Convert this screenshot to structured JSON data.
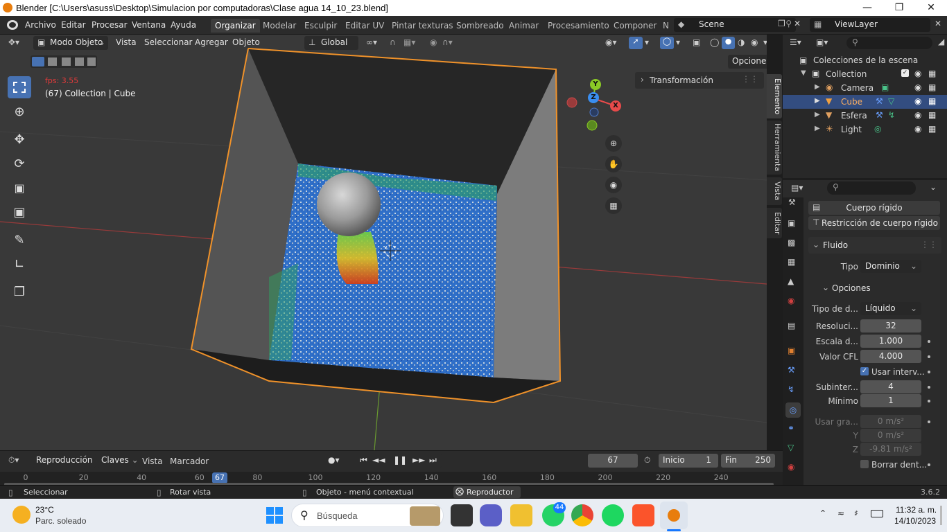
{
  "titlebar": {
    "title": "Blender [C:\\Users\\asuss\\Desktop\\Simulacion por computadoras\\Clase agua 14_10_23.blend]"
  },
  "menu": [
    "Archivo",
    "Editar",
    "Procesar",
    "Ventana",
    "Ayuda"
  ],
  "workspaces": [
    "Organizar",
    "Modelar",
    "Esculpir",
    "Editar UV",
    "Pintar texturas",
    "Sombreado",
    "Animar",
    "Procesamiento",
    "Componer",
    "N"
  ],
  "scene": "Scene",
  "view_layer": "ViewLayer",
  "viewport": {
    "mode": "Modo Objeto",
    "header_menus": [
      "Vista",
      "Seleccionar",
      "Agregar",
      "Objeto"
    ],
    "orientation": "Global",
    "options_label": "Opciones",
    "fps": "fps: 3.55",
    "info": "(67) Collection | Cube",
    "sidebar_panel": "Transformación",
    "gizmo_x": "X",
    "gizmo_y": "Y",
    "gizmo_z": "Z"
  },
  "side_tabs": [
    "Elemento",
    "Herramienta",
    "Vista",
    "Editar"
  ],
  "outliner": {
    "root": "Colecciones de la escena",
    "items": [
      {
        "name": "Collection",
        "level": 1
      },
      {
        "name": "Camera",
        "level": 2
      },
      {
        "name": "Cube",
        "level": 2,
        "selected": true
      },
      {
        "name": "Esfera",
        "level": 2
      },
      {
        "name": "Light",
        "level": 2
      }
    ]
  },
  "properties": {
    "btn_rigid": "Cuerpo rígido",
    "btn_rigid_constraint": "Restricción de cuerpo rígido",
    "panel_fluid": "Fluido",
    "tipo_label": "Tipo",
    "tipo_value": "Dominio",
    "subpanel_opciones": "Opciones",
    "rows": [
      {
        "label": "Tipo de d...",
        "value": "Líquido",
        "kind": "dropdown"
      },
      {
        "label": "Resoluci...",
        "value": "32",
        "kind": "field"
      },
      {
        "label": "Escala d...",
        "value": "1.000",
        "kind": "field",
        "dot": true
      },
      {
        "label": "Valor CFL",
        "value": "4.000",
        "kind": "field",
        "dot": true
      },
      {
        "label": "",
        "value": "Usar interv...",
        "kind": "checkbox",
        "checked": true,
        "dot": true
      },
      {
        "label": "Subinter...",
        "value": "4",
        "kind": "field",
        "dot": true
      },
      {
        "label": "Mínimo",
        "value": "1",
        "kind": "field",
        "dot": true
      },
      {
        "label": "Usar gra...",
        "value": "0 m/s²",
        "kind": "field",
        "dim": true,
        "dot": true
      },
      {
        "label": "Y",
        "value": "0 m/s²",
        "kind": "field",
        "dim": true
      },
      {
        "label": "Z",
        "value": "-9.81 m/s²",
        "kind": "field",
        "dim": true
      },
      {
        "label": "",
        "value": "Borrar dent...",
        "kind": "checkbox",
        "checked": false,
        "dot": true
      }
    ]
  },
  "timeline": {
    "menus": [
      "Reproducción",
      "Claves",
      "Vista",
      "Marcador"
    ],
    "current_frame": "67",
    "start_label": "Inicio",
    "start": "1",
    "end_label": "Fin",
    "end": "250",
    "ruler": [
      "0",
      "20",
      "40",
      "60",
      "80",
      "100",
      "120",
      "140",
      "160",
      "180",
      "200",
      "220",
      "240"
    ],
    "playhead": 67
  },
  "statusbar": {
    "select": "Seleccionar",
    "rotate": "Rotar vista",
    "context": "Objeto - menú contextual",
    "player": "Reproductor ...",
    "version": "3.6.2"
  },
  "taskbar": {
    "weather_temp": "23°C",
    "weather_desc": "Parc. soleado",
    "search": "Búsqueda",
    "badge": "44",
    "time": "11:32 a. m.",
    "date": "14/10/2023"
  }
}
